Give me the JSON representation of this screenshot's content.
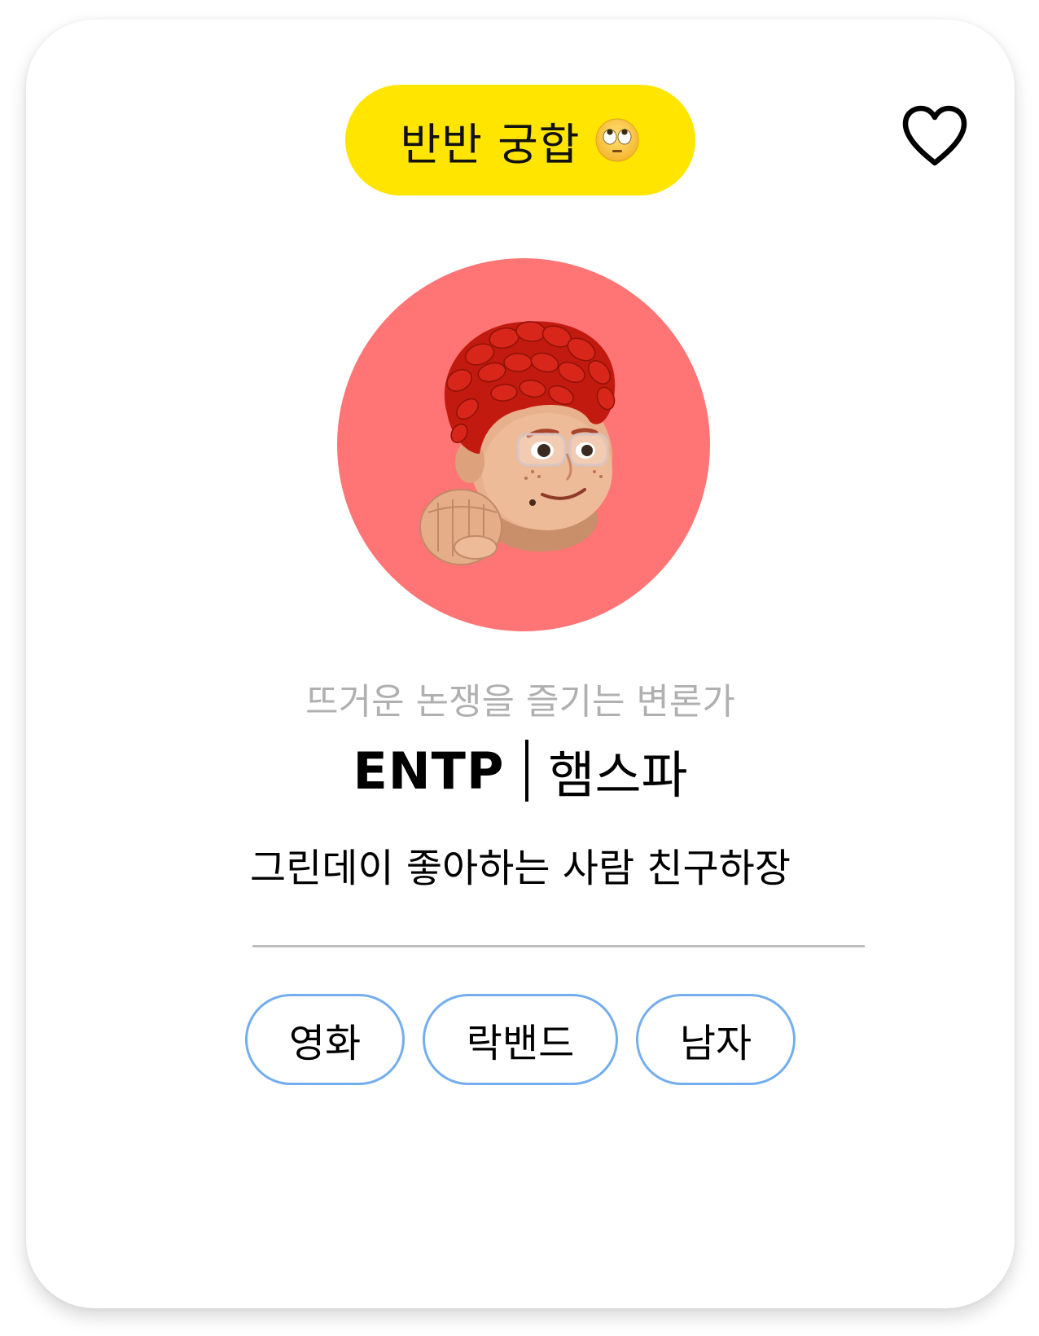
{
  "badge": {
    "label": "반반 궁합",
    "emoji_icon": "eye-roll-face-icon",
    "color": "#FFE500"
  },
  "favorite": {
    "icon": "heart-outline-icon"
  },
  "profile": {
    "avatar_icon": "memoji-avatar-icon",
    "avatar_bg": "#FF7474",
    "tagline": "뜨거운 논쟁을 즐기는 변론가",
    "mbti": "ENTP",
    "team": "햄스파",
    "bio": "그린데이 좋아하는 사람 친구하장"
  },
  "interests": [
    {
      "label": "영화"
    },
    {
      "label": "락밴드"
    },
    {
      "label": "남자"
    }
  ],
  "colors": {
    "chip_border": "#74AEEC",
    "tagline": "#B0B0B0",
    "divider": "#BDBDBD"
  }
}
